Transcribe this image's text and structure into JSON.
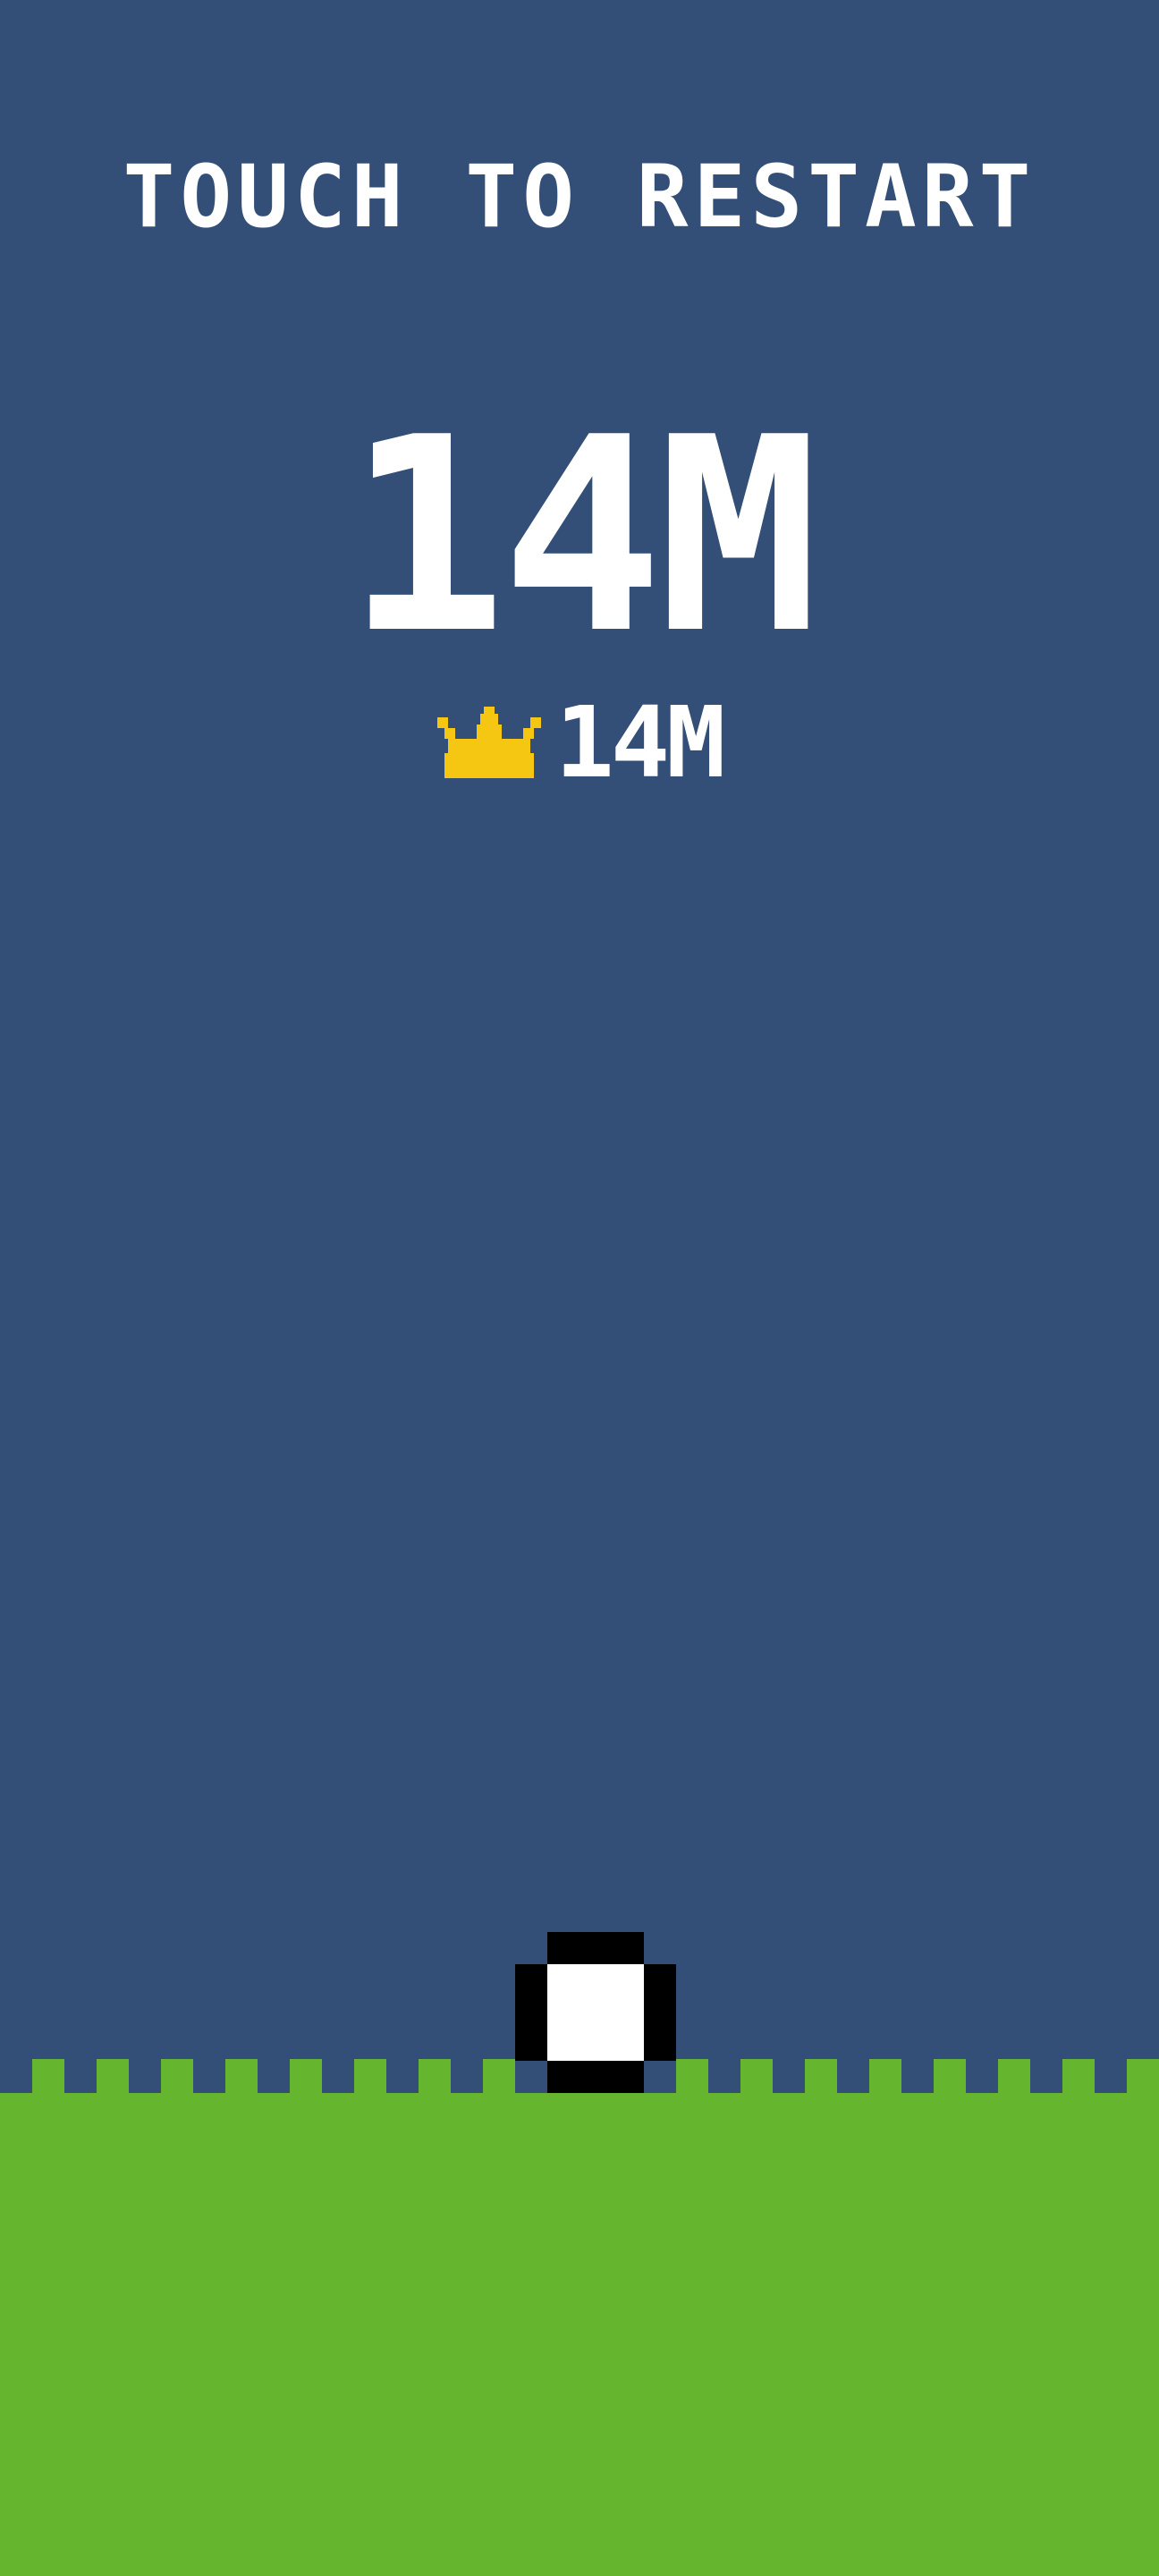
{
  "screen": {
    "restart_prompt": "TOUCH TO RESTART",
    "score": "14M",
    "best_score": "14M",
    "best_icon": "crown-icon"
  },
  "colors": {
    "sky": "#334f78",
    "grass": "#65b52f",
    "text": "#ffffff",
    "crown": "#f6c712",
    "ball_outline": "#000000",
    "ball_fill": "#ffffff"
  }
}
